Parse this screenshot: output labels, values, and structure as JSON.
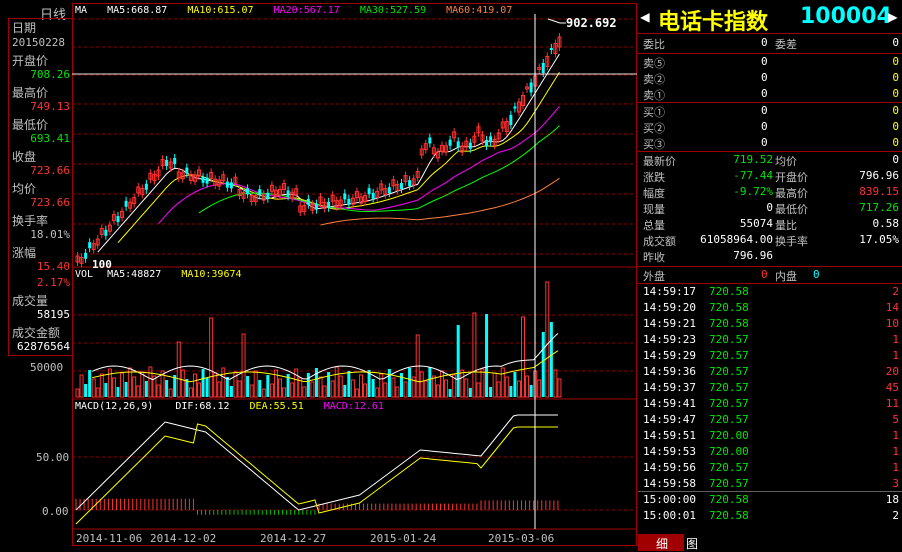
{
  "period_label": "日线",
  "left_panel": {
    "date_label": "日期",
    "date_value": "20150228",
    "open_label": "开盘价",
    "open_value": "708.26",
    "high_label": "最高价",
    "high_value": "749.13",
    "low_label": "最低价",
    "low_value": "693.41",
    "close_label": "收盘",
    "close_value": "723.66",
    "avg_label": "均价",
    "avg_value": "723.66",
    "turnover_label": "换手率",
    "turnover_value": "18.01%",
    "change_label": "涨幅",
    "change_value": "15.40",
    "change_pct": "2.17%",
    "volume_label": "成交量",
    "volume_value": "58195",
    "amount_label": "成交金额",
    "amount_value": "62876564"
  },
  "ma_legend": {
    "ma": "MA",
    "ma5": "MA5:668.87",
    "ma10": "MA10:615.07",
    "ma20": "MA20:567.17",
    "ma30": "MA30:527.59",
    "ma60": "MA60:419.07"
  },
  "price_max_label": "902.692",
  "price_min_label": "100",
  "vol_legend": {
    "vol": "VOL",
    "ma5": "MA5:48827",
    "ma10": "MA10:39674"
  },
  "vol_tick": "50000",
  "macd_legend": {
    "macd": "MACD(12,26,9)",
    "dif": "DIF:68.12",
    "dea": "DEA:55.51",
    "macd_val": "MACD:12.61"
  },
  "macd_ticks": [
    "50.00",
    "0.00"
  ],
  "date_ticks": [
    "2014-11-06",
    "2014-12-02",
    "2014-12-27",
    "2015-01-24",
    "2015-03-06"
  ],
  "header": {
    "left_arrow": "◀",
    "title": "电话卡指数",
    "code": "100004",
    "right_arrow": "▶"
  },
  "order_book": {
    "wb_label": "委比",
    "wb_value": "0",
    "wc_label": "委差",
    "wc_value": "0",
    "asks": [
      {
        "label": "卖⑤",
        "price": "0",
        "vol": "0"
      },
      {
        "label": "卖②",
        "price": "0",
        "vol": "0"
      },
      {
        "label": "卖①",
        "price": "0",
        "vol": "0"
      }
    ],
    "bids": [
      {
        "label": "买①",
        "price": "0",
        "vol": "0"
      },
      {
        "label": "买②",
        "price": "0",
        "vol": "0"
      },
      {
        "label": "买③",
        "price": "0",
        "vol": "0"
      }
    ]
  },
  "quote": [
    {
      "l1": "最新价",
      "v1": "719.52",
      "c1": "grn",
      "l2": "均价",
      "v2": "0",
      "c2": "wht"
    },
    {
      "l1": "涨跌",
      "v1": "-77.44",
      "c1": "grn",
      "l2": "开盘价",
      "v2": "796.96",
      "c2": "wht"
    },
    {
      "l1": "幅度",
      "v1": "-9.72%",
      "c1": "grn",
      "l2": "最高价",
      "v2": "839.15",
      "c2": "red"
    },
    {
      "l1": "现量",
      "v1": "0",
      "c1": "wht",
      "l2": "最低价",
      "v2": "717.26",
      "c2": "grn"
    },
    {
      "l1": "总量",
      "v1": "55074",
      "c1": "wht",
      "l2": "量比",
      "v2": "0.58",
      "c2": "wht"
    },
    {
      "l1": "成交额",
      "v1": "61058964.00",
      "c1": "wht",
      "l2": "换手率",
      "v2": "17.05%",
      "c2": "wht"
    },
    {
      "l1": "昨收",
      "v1": "796.96",
      "c1": "wht",
      "l2": "",
      "v2": "",
      "c2": "wht"
    }
  ],
  "outer_label": "外盘",
  "outer_value": "0",
  "inner_label": "内盘",
  "inner_value": "0",
  "ticks": [
    {
      "time": "14:59:17",
      "price": "720.58",
      "vol": "2",
      "c": "red"
    },
    {
      "time": "14:59:20",
      "price": "720.58",
      "vol": "14",
      "c": "red"
    },
    {
      "time": "14:59:21",
      "price": "720.58",
      "vol": "10",
      "c": "red"
    },
    {
      "time": "14:59:23",
      "price": "720.57",
      "vol": "1",
      "c": "red"
    },
    {
      "time": "14:59:29",
      "price": "720.57",
      "vol": "1",
      "c": "red"
    },
    {
      "time": "14:59:36",
      "price": "720.57",
      "vol": "20",
      "c": "red"
    },
    {
      "time": "14:59:37",
      "price": "720.57",
      "vol": "45",
      "c": "red"
    },
    {
      "time": "14:59:41",
      "price": "720.57",
      "vol": "11",
      "c": "red"
    },
    {
      "time": "14:59:47",
      "price": "720.57",
      "vol": "5",
      "c": "red"
    },
    {
      "time": "14:59:51",
      "price": "720.00",
      "vol": "1",
      "c": "red"
    },
    {
      "time": "14:59:53",
      "price": "720.00",
      "vol": "1",
      "c": "red"
    },
    {
      "time": "14:59:56",
      "price": "720.57",
      "vol": "1",
      "c": "red"
    },
    {
      "time": "14:59:58",
      "price": "720.57",
      "vol": "3",
      "c": "red"
    },
    {
      "time": "15:00:00",
      "price": "720.58",
      "vol": "18",
      "c": "wht"
    },
    {
      "time": "15:00:01",
      "price": "720.58",
      "vol": "2",
      "c": "wht"
    }
  ],
  "bottom_tabs": [
    "细",
    "图"
  ],
  "colors": {
    "up": "#ff3232",
    "down": "#00ffff",
    "ma5": "#ffffff",
    "ma10": "#ffff00",
    "ma20": "#ff00ff",
    "ma30": "#00ff00",
    "ma60": "#ff8040",
    "frame": "#a00000"
  }
}
